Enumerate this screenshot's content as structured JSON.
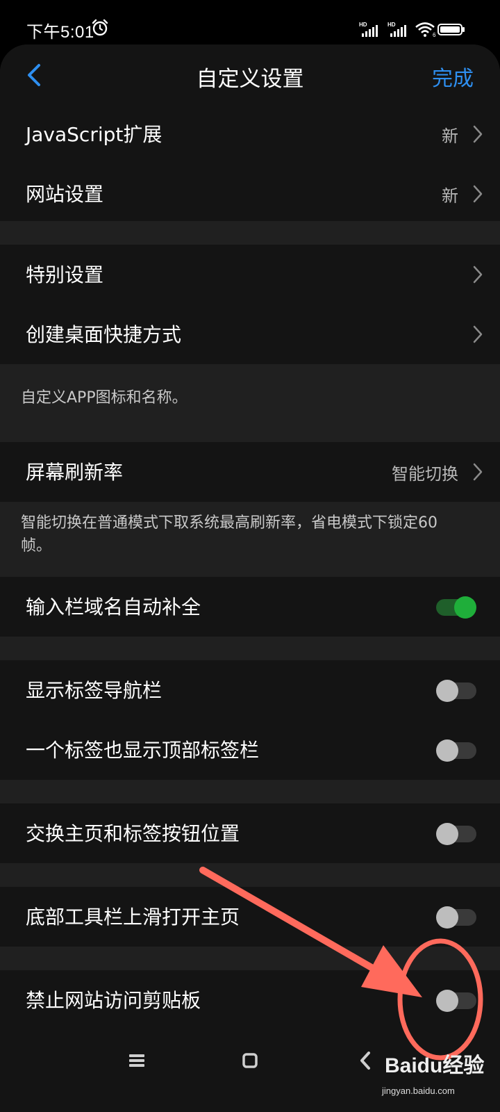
{
  "status_bar": {
    "time": "下午5:01",
    "signal_1_label": "HD",
    "signal_2_label": "HD",
    "wifi_label": "6",
    "battery_icon": "battery-icon"
  },
  "header": {
    "title": "自定义设置",
    "done_label": "完成"
  },
  "rows": {
    "javascript": {
      "label": "JavaScript扩展",
      "value": "新"
    },
    "site_settings": {
      "label": "网站设置",
      "value": "新"
    },
    "special_settings": {
      "label": "特别设置"
    },
    "desktop_shortcut": {
      "label": "创建桌面快捷方式"
    },
    "refresh_rate": {
      "label": "屏幕刷新率",
      "value": "智能切换"
    },
    "autocomplete": {
      "label": "输入栏域名自动补全",
      "enabled": true
    },
    "show_tab_nav": {
      "label": "显示标签导航栏",
      "enabled": false
    },
    "single_tab_top": {
      "label": "一个标签也显示顶部标签栏",
      "enabled": false
    },
    "swap_home_tabs": {
      "label": "交换主页和标签按钮位置",
      "enabled": false
    },
    "swipe_home": {
      "label": "底部工具栏上滑打开主页",
      "enabled": false
    },
    "block_clipboard": {
      "label": "禁止网站访问剪贴板",
      "enabled": false
    }
  },
  "notes": {
    "shortcut": "自定义APP图标和名称。",
    "refresh_rate": "智能切换在普通模式下取系统最高刷新率，省电模式下锁定60帧。"
  },
  "watermark": {
    "brand": "Baidu经验",
    "url": "jingyan.baidu.com"
  },
  "colors": {
    "accent": "#2e8ff0",
    "toggle_on": "#1fae3a",
    "annotation": "#ff6a5c"
  }
}
